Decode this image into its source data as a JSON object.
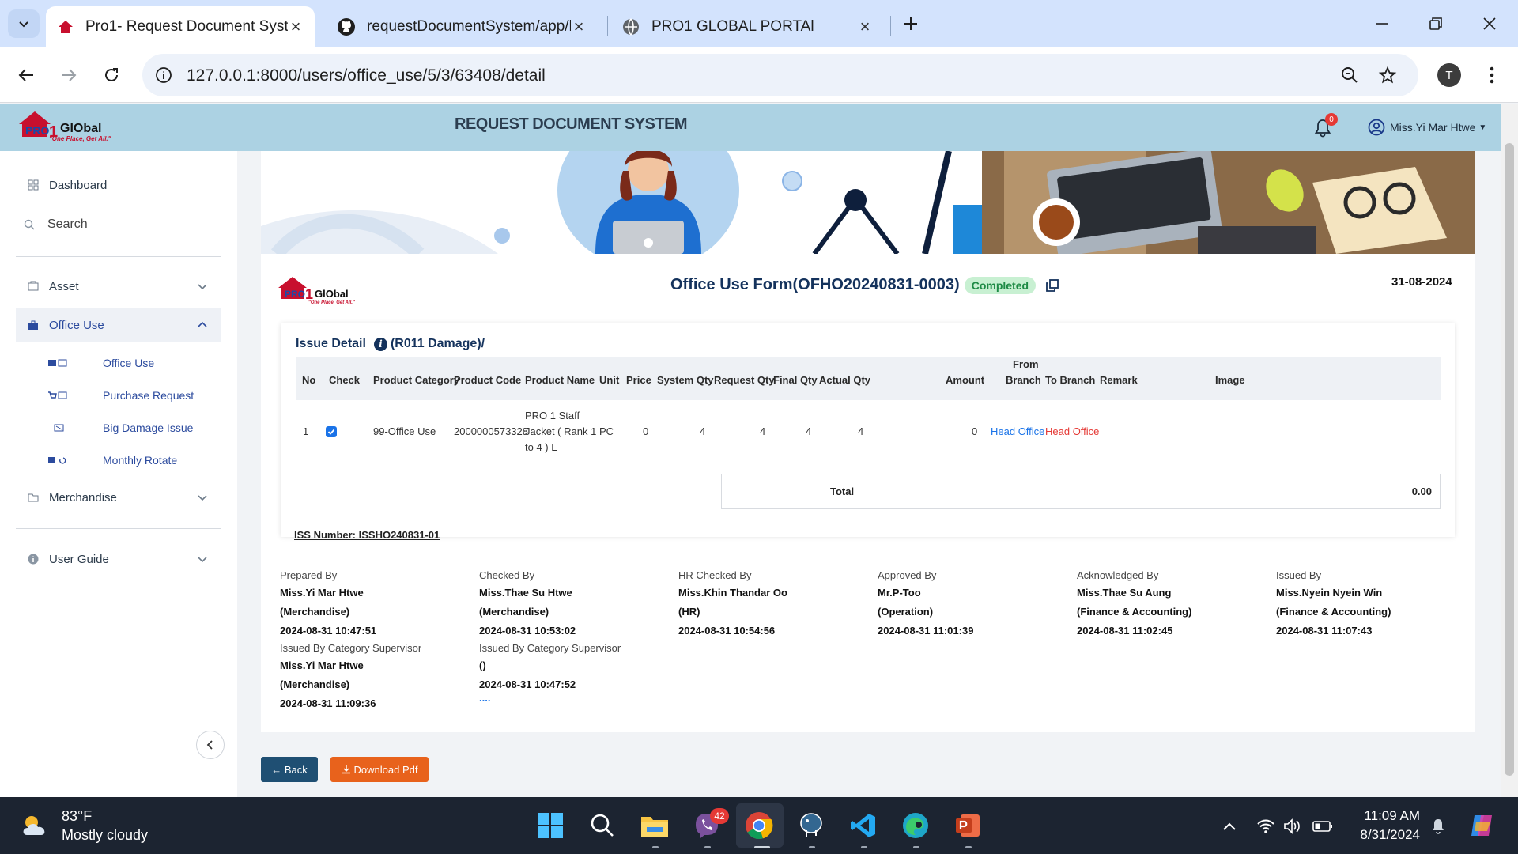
{
  "browser": {
    "tabs": [
      {
        "title": "Pro1- Request Document Syste",
        "active": true
      },
      {
        "title": "requestDocumentSystem/app/l"
      },
      {
        "title": "PRO1 GLOBAL PORTAl"
      }
    ],
    "url": "127.0.0.1:8000/users/office_use/5/3/63408/detail",
    "profile_initial": "T"
  },
  "header": {
    "logo_pro": "PRO1",
    "logo_global": "GlObal",
    "logo_tagline": "\"One Place, Get All.\"",
    "title": "REQUEST DOCUMENT SYSTEM",
    "notification_count": "0",
    "user_name": "Miss.Yi Mar Htwe"
  },
  "sidebar": {
    "dashboard": "Dashboard",
    "search_placeholder": "Search",
    "asset": "Asset",
    "office_use": "Office Use",
    "sub_items": [
      "Office Use",
      "Purchase Request",
      "Big Damage Issue",
      "Monthly Rotate"
    ],
    "merchandise": "Merchandise",
    "user_guide": "User Guide"
  },
  "form": {
    "title": "Office Use Form(OFHO20240831-0003)",
    "status": "Completed",
    "date": "31-08-2024",
    "issue_heading": "Issue Detail",
    "issue_reason": "(R011 Damage)/",
    "columns": {
      "no": "No",
      "check": "Check",
      "category": "Product Category",
      "code": "Product Code",
      "name": "Product Name",
      "unit": "Unit",
      "price": "Price",
      "system_qty": "System Qty",
      "request_qty": "Request Qty",
      "final_qty": "Final Qty",
      "actual_qty": "Actual Qty",
      "amount": "Amount",
      "from_branch_1": "From",
      "from_branch_2": "Branch",
      "to_branch": "To Branch",
      "remark": "Remark",
      "image": "Image"
    },
    "row": {
      "no": "1",
      "checked": true,
      "category": "99-Office Use",
      "code": "2000000573328",
      "name_line1": "PRO 1 Staff",
      "name_line2": "Jacket ( Rank 1",
      "name_line3": "to 4 ) L",
      "unit": "PC",
      "price": "0",
      "system_qty": "4",
      "request_qty": "4",
      "final_qty": "4",
      "actual_qty": "4",
      "amount": "0",
      "from_branch": "Head Office",
      "to_branch": "Head Office"
    },
    "total_label": "Total",
    "total_value": "0.00",
    "iss_number": "ISS Number: ISSHO240831-01"
  },
  "signatures": [
    {
      "label": "Prepared By",
      "name": "Miss.Yi Mar Htwe",
      "dept": "(Merchandise)",
      "time": "2024-08-31 10:47:51"
    },
    {
      "label": "Checked By",
      "name": "Miss.Thae Su Htwe",
      "dept": "(Merchandise)",
      "time": "2024-08-31 10:53:02"
    },
    {
      "label": "HR Checked By",
      "name": "Miss.Khin Thandar Oo",
      "dept": "(HR)",
      "time": "2024-08-31 10:54:56"
    },
    {
      "label": "Approved By",
      "name": "Mr.P-Too",
      "dept": "(Operation)",
      "time": "2024-08-31 11:01:39"
    },
    {
      "label": "Acknowledged By",
      "name": "Miss.Thae Su Aung",
      "dept": "(Finance & Accounting)",
      "time": "2024-08-31 11:02:45"
    },
    {
      "label": "Issued By",
      "name": "Miss.Nyein Nyein Win",
      "dept": "(Finance & Accounting)",
      "time": "2024-08-31 11:07:43"
    },
    {
      "label": "Issued By Category Supervisor",
      "name": "Miss.Yi Mar Htwe",
      "dept": "(Merchandise)",
      "time": "2024-08-31 11:09:36"
    },
    {
      "label": "Issued By Category Supervisor",
      "name": "()",
      "dept": "",
      "time": "2024-08-31 10:47:52",
      "extra": "...."
    }
  ],
  "actions": {
    "back": "← Back",
    "download": "Download Pdf"
  },
  "taskbar": {
    "temperature": "83°F",
    "weather": "Mostly cloudy",
    "viber_badge": "42",
    "time": "11:09 AM",
    "date": "8/31/2024"
  },
  "colors": {
    "header_bg": "#acd2e3",
    "accent": "#14325c",
    "status_green": "#1e8a45",
    "branch_from": "#1a73e8",
    "branch_to": "#e53935",
    "back_btn": "#1f4f73",
    "pdf_btn": "#e8621c"
  }
}
